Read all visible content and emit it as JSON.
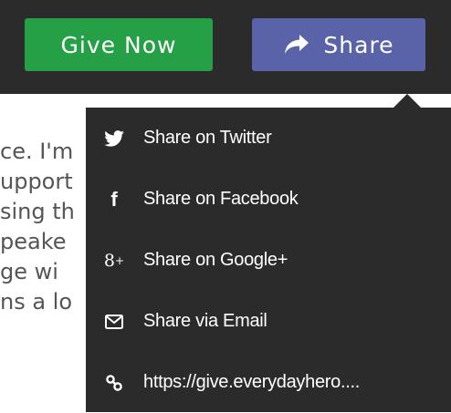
{
  "header": {
    "give_now_label": "Give Now",
    "share_label": "Share"
  },
  "background_text": [
    "ce. I'm",
    "upport",
    "sing th",
    "peake",
    "ge wi",
    "ns a lo"
  ],
  "share_menu": {
    "items": [
      {
        "label": "Share on Twitter",
        "icon": "twitter-icon"
      },
      {
        "label": "Share on Facebook",
        "icon": "facebook-icon"
      },
      {
        "label": "Share on Google+",
        "icon": "google-plus-icon"
      },
      {
        "label": "Share via Email",
        "icon": "email-icon"
      },
      {
        "label": "https://give.everydayhero....",
        "icon": "link-icon"
      }
    ]
  },
  "colors": {
    "dark_bar": "#2b2b2b",
    "give_now_green": "#26a046",
    "share_purple": "#5b63a8"
  }
}
